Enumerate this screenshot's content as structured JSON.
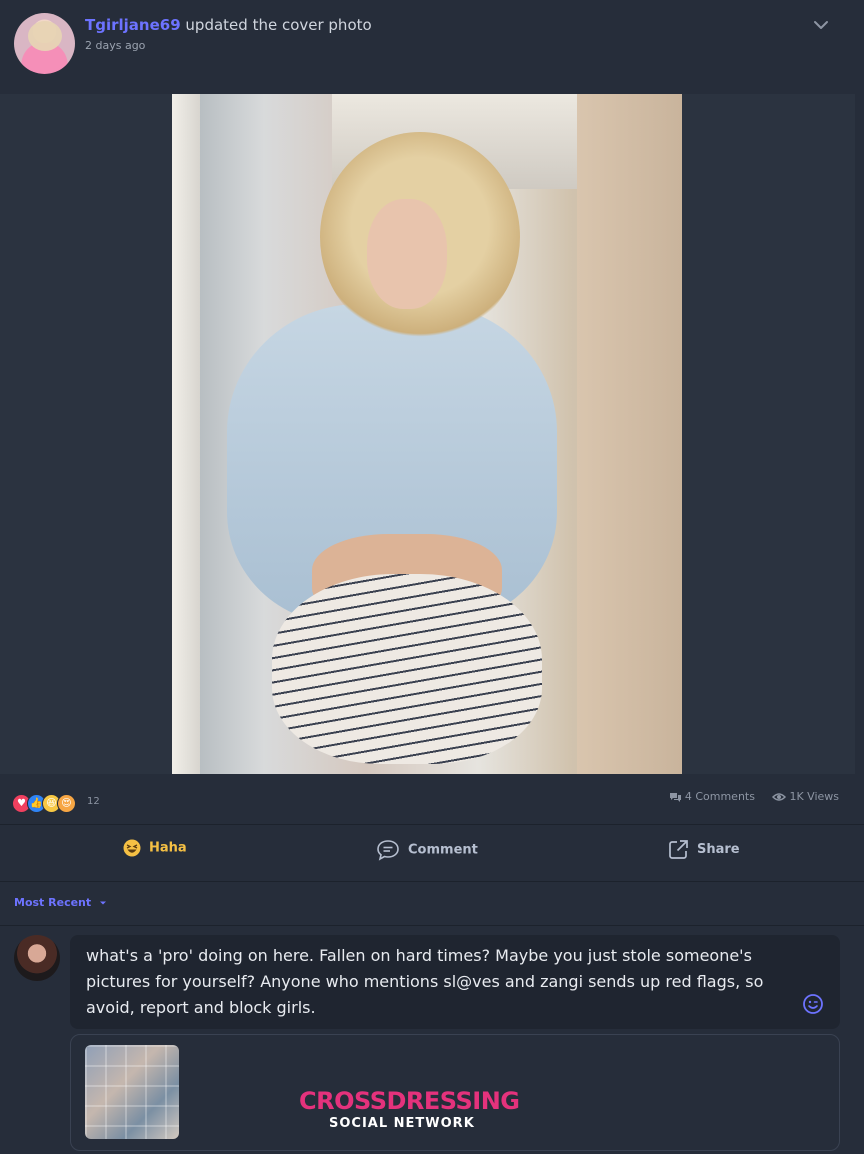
{
  "post": {
    "author": "Tgirljane69",
    "action_text": "updated the cover photo",
    "time": "2 days ago"
  },
  "reactions": {
    "icons": [
      "love-icon",
      "like-icon",
      "haha-icon",
      "wow-icon"
    ],
    "count": "12"
  },
  "stats": {
    "comments": "4 Comments",
    "views": "1K Views"
  },
  "actions": {
    "haha": "Haha",
    "comment": "Comment",
    "share": "Share"
  },
  "sort": {
    "label": "Most Recent"
  },
  "comment_input": {
    "value": "what's a 'pro' doing on here. Fallen on hard times? Maybe you just stole someone's pictures for yourself? Anyone who mentions sl@ves and zangi sends up red flags, so avoid, report and block girls."
  },
  "link_preview": {
    "brand": "CROSSDRESSING",
    "subtitle": "SOCIAL NETWORK"
  },
  "colors": {
    "background": "#262d3a",
    "accent": "#6d73ff",
    "haha": "#f5c044",
    "brand": "#e4327c"
  }
}
